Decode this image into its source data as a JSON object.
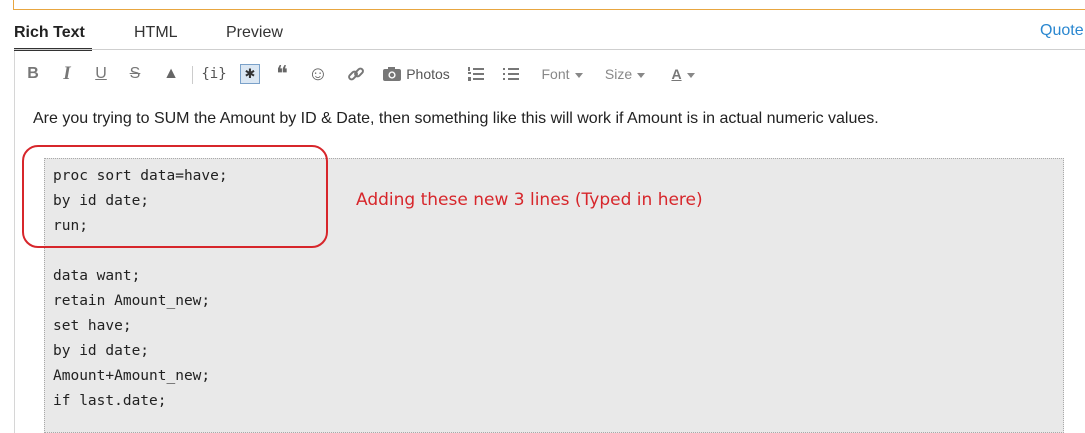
{
  "tabs": [
    {
      "label": "Rich Text",
      "active": true
    },
    {
      "label": "HTML",
      "active": false
    },
    {
      "label": "Preview",
      "active": false
    }
  ],
  "quote_link": "Quote",
  "toolbar": {
    "bold": "B",
    "italic": "I",
    "underline": "U",
    "strike": "S",
    "warning": "▲",
    "code": "{i}",
    "spoiler": "✱",
    "quote": "❝",
    "emoji": "☺",
    "link": "🔗",
    "photos_label": "Photos",
    "font_label": "Font",
    "size_label": "Size",
    "color_label": "A"
  },
  "editor": {
    "intro": "Are you trying to SUM the Amount by ID & Date, then something like this will work if Amount is in actual numeric values.",
    "code_lines": [
      "proc sort data=have;",
      "by id date;",
      "run;",
      "",
      "data want;",
      "retain Amount_new;",
      "set have;",
      "by id date;",
      "Amount+Amount_new;",
      "if last.date;"
    ],
    "annotation": "Adding these new 3 lines (Typed in here)"
  },
  "colors": {
    "annotation": "#d7262b",
    "link": "#2a87d0",
    "code_bg": "#e9e9e9"
  }
}
